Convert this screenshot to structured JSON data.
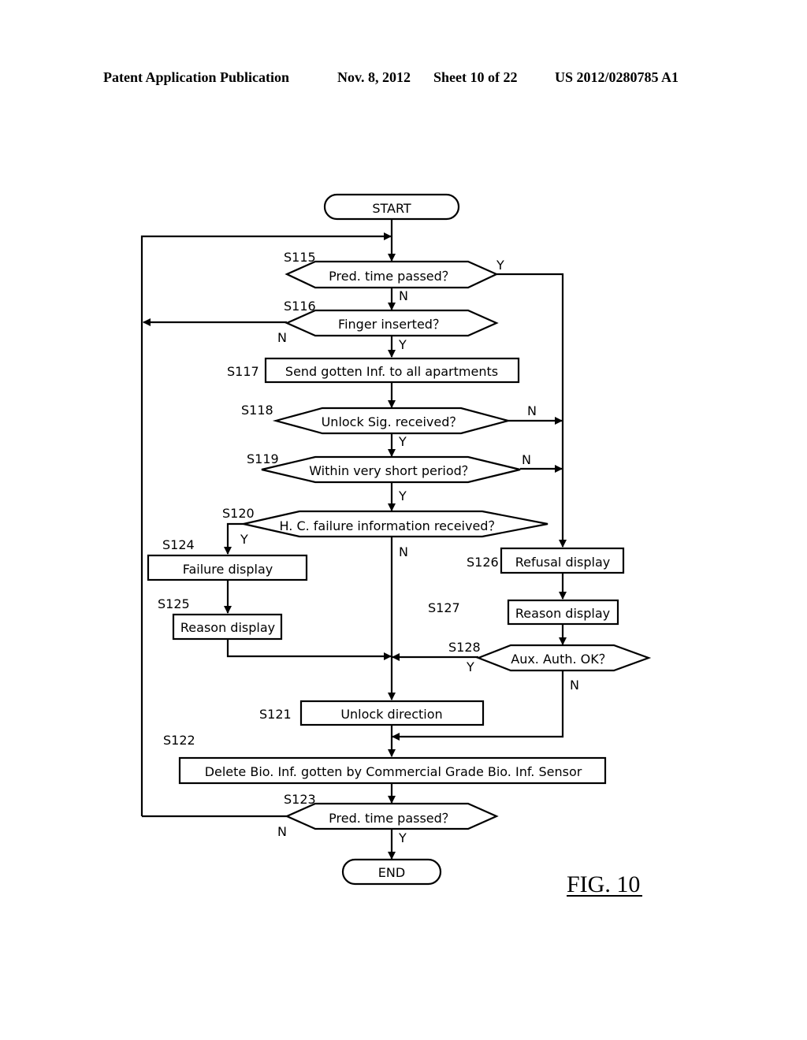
{
  "header": {
    "publication": "Patent Application Publication",
    "date": "Nov. 8, 2012",
    "sheet": "Sheet 10 of 22",
    "number": "US 2012/0280785 A1"
  },
  "figure_label": "FIG. 10",
  "flowchart": {
    "terminals": {
      "start": "START",
      "end": "END"
    },
    "steps": {
      "s115": {
        "id": "S115",
        "text": "Pred. time passed？",
        "type": "decision"
      },
      "s116": {
        "id": "S116",
        "text": "Finger inserted？",
        "type": "decision"
      },
      "s117": {
        "id": "S117",
        "text": "Send gotten Inf. to all apartments",
        "type": "process"
      },
      "s118": {
        "id": "S118",
        "text": "Unlock Sig. received？",
        "type": "decision"
      },
      "s119": {
        "id": "S119",
        "text": "Within very short period？",
        "type": "decision"
      },
      "s120": {
        "id": "S120",
        "text": "H. C. failure information received？",
        "type": "decision"
      },
      "s121": {
        "id": "S121",
        "text": "Unlock direction",
        "type": "process"
      },
      "s122": {
        "id": "S122",
        "text": "Delete Bio. Inf. gotten by Commercial Grade Bio. Inf. Sensor",
        "type": "process"
      },
      "s123": {
        "id": "S123",
        "text": "Pred. time passed？",
        "type": "decision"
      },
      "s124": {
        "id": "S124",
        "text": "Failure display",
        "type": "process"
      },
      "s125": {
        "id": "S125",
        "text": "Reason display",
        "type": "process"
      },
      "s126": {
        "id": "S126",
        "text": "Refusal display",
        "type": "process"
      },
      "s127": {
        "id": "S127",
        "text": "Reason display",
        "type": "process"
      },
      "s128": {
        "id": "S128",
        "text": "Aux. Auth. OK？",
        "type": "decision"
      }
    },
    "branch_labels": {
      "yes": "Y",
      "no": "N"
    },
    "edges": [
      {
        "from": "START",
        "to": "S115"
      },
      {
        "from": "S115",
        "to": "S116",
        "label": "N"
      },
      {
        "from": "S115",
        "to": "S126",
        "label": "Y"
      },
      {
        "from": "S116",
        "to": "S115",
        "label": "N"
      },
      {
        "from": "S116",
        "to": "S117",
        "label": "Y"
      },
      {
        "from": "S117",
        "to": "S118"
      },
      {
        "from": "S118",
        "to": "S119",
        "label": "Y"
      },
      {
        "from": "S118",
        "to": "S126",
        "label": "N"
      },
      {
        "from": "S119",
        "to": "S120",
        "label": "Y"
      },
      {
        "from": "S119",
        "to": "S126",
        "label": "N"
      },
      {
        "from": "S120",
        "to": "S124",
        "label": "Y"
      },
      {
        "from": "S120",
        "to": "S121",
        "label": "N"
      },
      {
        "from": "S124",
        "to": "S125"
      },
      {
        "from": "S125",
        "to": "S121"
      },
      {
        "from": "S126",
        "to": "S127"
      },
      {
        "from": "S127",
        "to": "S128"
      },
      {
        "from": "S128",
        "to": "S121",
        "label": "Y"
      },
      {
        "from": "S128",
        "to": "S122",
        "label": "N"
      },
      {
        "from": "S121",
        "to": "S122"
      },
      {
        "from": "S122",
        "to": "S123"
      },
      {
        "from": "S123",
        "to": "END",
        "label": "Y"
      },
      {
        "from": "S123",
        "to": "S115",
        "label": "N"
      }
    ]
  }
}
